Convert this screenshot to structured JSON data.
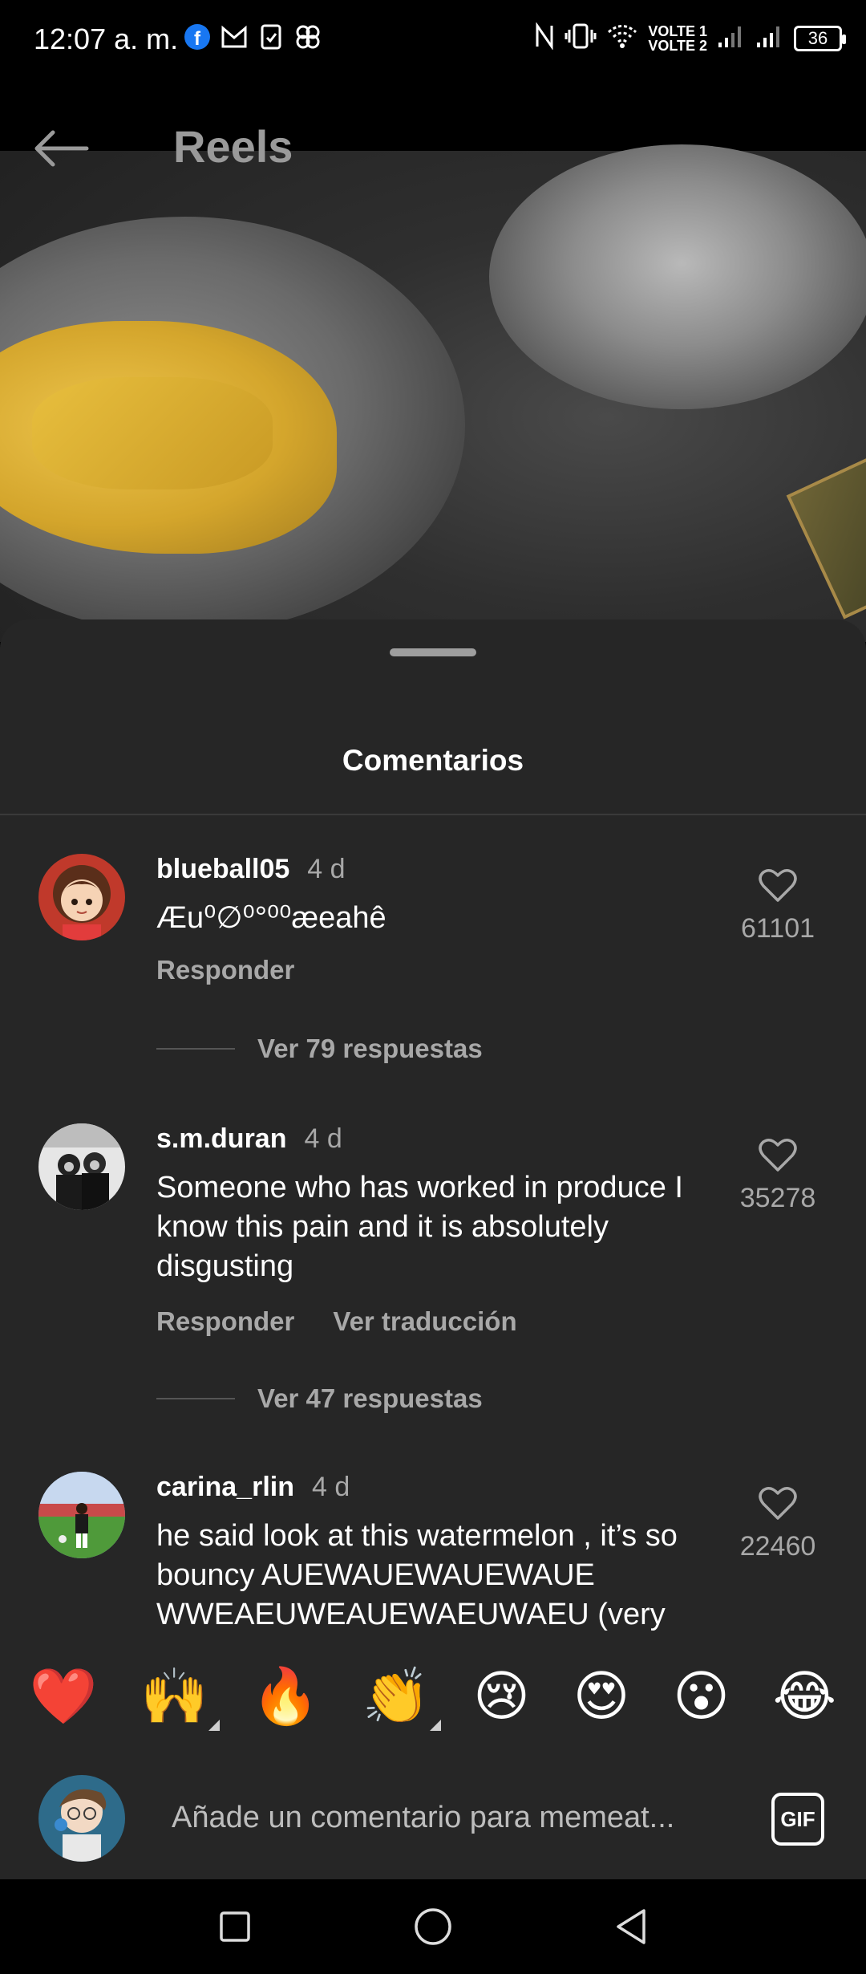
{
  "status_bar": {
    "time": "12:07 a. m.",
    "volte1": "VOLTE 1",
    "volte2": "VOLTE 2",
    "battery": "36",
    "app_icons": [
      "facebook-icon",
      "gmail-icon",
      "sim-manager-icon",
      "pinwheel-icon"
    ]
  },
  "header": {
    "title": "Reels"
  },
  "sheet": {
    "title": "Comentarios"
  },
  "comments": [
    {
      "username": "blueball05",
      "time": "4 d",
      "text": "Æu⁰∅⁰°⁰⁰æeahê",
      "reply_label": "Responder",
      "translate_label": "",
      "likes": "61101",
      "view_replies": "Ver 79 respuestas"
    },
    {
      "username": "s.m.duran",
      "time": "4 d",
      "text": "Someone who has worked in produce I know this pain and it is absolutely disgusting",
      "reply_label": "Responder",
      "translate_label": "Ver traducción",
      "likes": "35278",
      "view_replies": "Ver 47 respuestas"
    },
    {
      "username": "carina_rlin",
      "time": "4 d",
      "text": "he said look at this watermelon , it’s so bouncy AUEWAUEWAUEWAUE WWEAEUWEAUEWAEUWAEU (very",
      "likes": "22460"
    }
  ],
  "emoji_bar": [
    "❤️",
    "🙌",
    "🔥",
    "👏",
    "😢",
    "😍",
    "😮",
    "😂"
  ],
  "input": {
    "placeholder": "Añade un comentario para memeat...",
    "gif_label": "GIF"
  },
  "colors": {
    "sheet_bg": "#262626",
    "secondary_text": "#a8a8a8",
    "heart_red": "#e0102a"
  }
}
